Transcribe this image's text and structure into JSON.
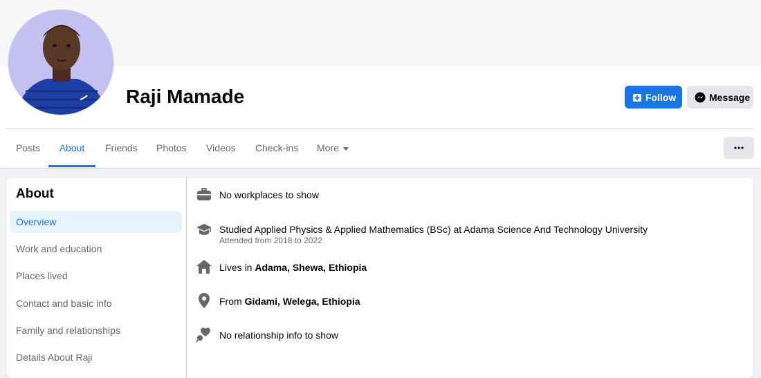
{
  "profile": {
    "name": "Raji Mamade",
    "follow_label": "Follow",
    "message_label": "Message"
  },
  "tabs": [
    {
      "label": "Posts"
    },
    {
      "label": "About"
    },
    {
      "label": "Friends"
    },
    {
      "label": "Photos"
    },
    {
      "label": "Videos"
    },
    {
      "label": "Check-ins"
    },
    {
      "label": "More"
    }
  ],
  "active_tab": "About",
  "about": {
    "title": "About",
    "nav": [
      {
        "label": "Overview"
      },
      {
        "label": "Work and education"
      },
      {
        "label": "Places lived"
      },
      {
        "label": "Contact and basic info"
      },
      {
        "label": "Family and relationships"
      },
      {
        "label": "Details About Raji"
      }
    ],
    "active_nav": "Overview",
    "work": "No workplaces to show",
    "education": {
      "text": "Studied Applied Physics & Applied Mathematics (BSc) at Adama Science And Technology University",
      "subtext": "Attended from 2018 to 2022"
    },
    "lives": {
      "prefix": "Lives in",
      "place": "Adama, Shewa, Ethiopia"
    },
    "from": {
      "prefix": "From",
      "place": "Gidami, Welega, Ethiopia"
    },
    "relationship": "No relationship info to show"
  },
  "colors": {
    "accent": "#1b74e4",
    "page_bg": "#f0f2f5",
    "secondary_text": "#65676b",
    "icon_gray": "#65676b"
  },
  "icons": {
    "work": "briefcase-icon",
    "education": "graduation-cap-icon",
    "lives": "house-icon",
    "from": "location-pin-icon",
    "relationship": "hearts-icon"
  }
}
